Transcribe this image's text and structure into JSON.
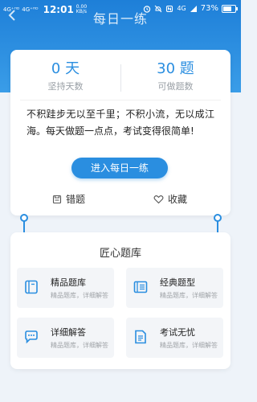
{
  "status_bar": {
    "signal_1": "4G⁺ᴴᴰ",
    "signal_2": "4G⁺ᴴᴰ",
    "time": "12:01",
    "net_speed": "0.00 KB/s",
    "right_net": "4G",
    "battery_text": "73%",
    "battery_level": 0.73
  },
  "header": {
    "title": "每日一练"
  },
  "stats": {
    "days_value": "0 天",
    "days_label": "坚持天数",
    "questions_value": "30 题",
    "questions_label": "可做题数"
  },
  "quote": "不积跬步无以至千里；不积小流，无以成江海。每天做题一点点，考试变得很简单!",
  "practice_button": "进入每日一练",
  "links": {
    "wrong": "错题",
    "favorites": "收藏"
  },
  "library": {
    "title": "匠心题库",
    "items": [
      {
        "name": "精品题库",
        "desc": "精品题库，详细解答",
        "icon": "book-icon"
      },
      {
        "name": "经典题型",
        "desc": "精品题库，详细解答",
        "icon": "list-icon"
      },
      {
        "name": "详细解答",
        "desc": "精品题库，详细解答",
        "icon": "chat-icon"
      },
      {
        "name": "考试无忧",
        "desc": "精品题库，详细解答",
        "icon": "document-icon"
      }
    ]
  },
  "colors": {
    "accent": "#2a8ee0",
    "header_top": "#1e7fd8",
    "background": "#eef3f9"
  }
}
